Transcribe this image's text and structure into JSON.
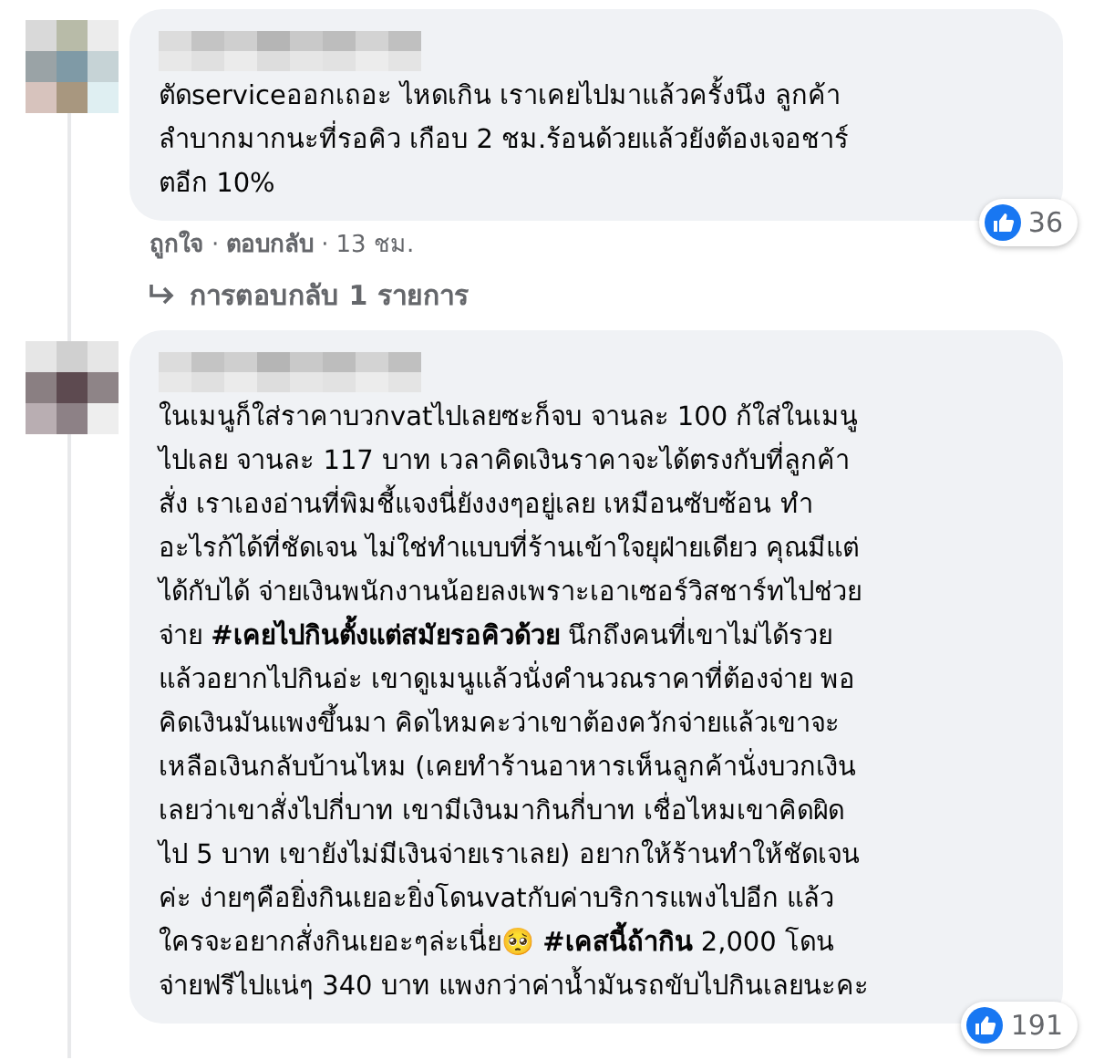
{
  "comments": [
    {
      "lines": [
        "ตัดserviceออกเถอะ ไหดเกิน เราเคยไปมาแล้วครั้งนึง ลูกค้า",
        "ลำบากมากนะที่รอคิว เกือบ 2 ชม.ร้อนด้วยแล้วยังต้องเจอชาร์",
        "ตอีก 10%"
      ],
      "reactions": "36",
      "actions": {
        "like": "ถูกใจ",
        "separator": "·",
        "reply": "ตอบกลับ",
        "time": "13 ชม."
      },
      "replies_link": "การตอบกลับ 1 รายการ"
    },
    {
      "lines": [
        "ในเมนูก็ใส่ราคาบวกvatไปเลยซะก็จบ จานละ 100 ก้ใส่ในเมนู",
        "ไปเลย จานละ 117 บาท เวลาคิดเงินราคาจะได้ตรงกับที่ลูกค้า",
        "สั่ง เราเองอ่านที่พิมชี้แจงนี่ยังงงๆอยู่เลย เหมือนซับซ้อน ทำ",
        "อะไรก้ได้ที่ชัดเจน ไม่ใช่ทำแบบที่ร้านเข้าใจยุฝ่ายเดียว คุณมีแต่",
        "ได้กับได้ จ่ายเงินพนักงานน้อยลงเพราะเอาเซอร์วิสชาร์ทไปช่วย",
        "จ่าย **#เคยไปกินตั้งแต่สมัยรอคิวด้วย** นึกถึงคนที่เขาไม่ได้รวย",
        "แล้วอยากไปกินอ่ะ เขาดูเมนูแล้วนั่งคำนวณราคาที่ต้องจ่าย พอ",
        "คิดเงินมันแพงขึ้นมา คิดไหมคะว่าเขาต้องควักจ่ายแล้วเขาจะ",
        "เหลือเงินกลับบ้านไหม (เคยทำร้านอาหารเห็นลูกค้านั่งบวกเงิน",
        "เลยว่าเขาสั่งไปกี่บาท เขามีเงินมากินกี่บาท เชื่อไหมเขาคิดผิด",
        "ไป 5 บาท เขายังไม่มีเงินจ่ายเราเลย) อยากให้ร้านทำให้ชัดเจน",
        "ค่ะ ง่ายๆคือยิ่งกินเยอะยิ่งโดนvatกับค่าบริการแพงไปอีก แล้ว",
        "ใครจะอยากสั่งกินเยอะๆล่ะเนี่ย🥺 **#เคสนี้ถ้ากิน** 2,000 โดน",
        "จ่ายฟรีไปแน่ๆ 340 บาท แพงกว่าค่าน้ำมันรถขับไปกินเลยนะคะ"
      ],
      "reactions": "191"
    }
  ]
}
